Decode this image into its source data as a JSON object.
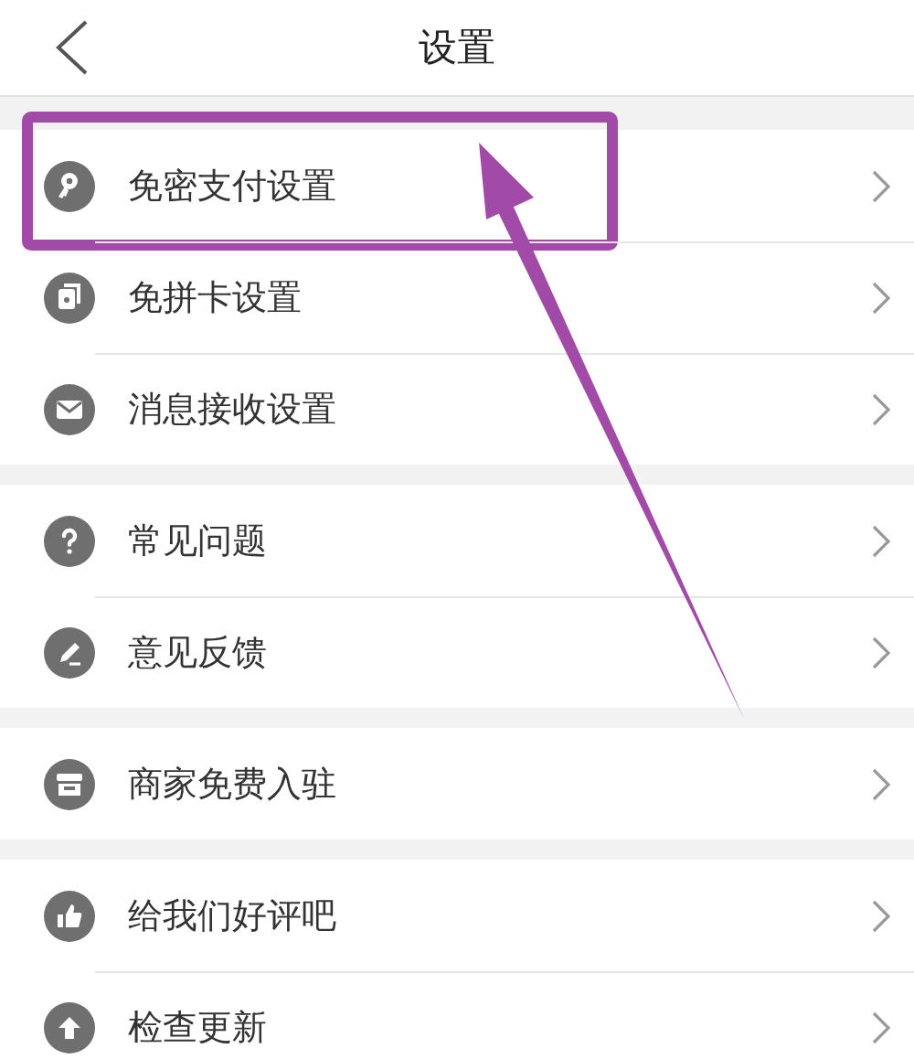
{
  "header": {
    "title": "设置"
  },
  "groups": [
    {
      "items": [
        {
          "label": "免密支付设置",
          "kind": "key",
          "highlighted": true
        },
        {
          "label": "免拼卡设置",
          "kind": "cards",
          "highlighted": false
        },
        {
          "label": "消息接收设置",
          "kind": "mail",
          "highlighted": false
        }
      ]
    },
    {
      "items": [
        {
          "label": "常见问题",
          "kind": "question",
          "highlighted": false
        },
        {
          "label": "意见反馈",
          "kind": "pencil",
          "highlighted": false
        }
      ]
    },
    {
      "items": [
        {
          "label": "商家免费入驻",
          "kind": "store",
          "highlighted": false
        }
      ]
    },
    {
      "items": [
        {
          "label": "给我们好评吧",
          "kind": "thumb",
          "highlighted": false
        },
        {
          "label": "检查更新",
          "kind": "update",
          "highlighted": false
        }
      ]
    }
  ]
}
